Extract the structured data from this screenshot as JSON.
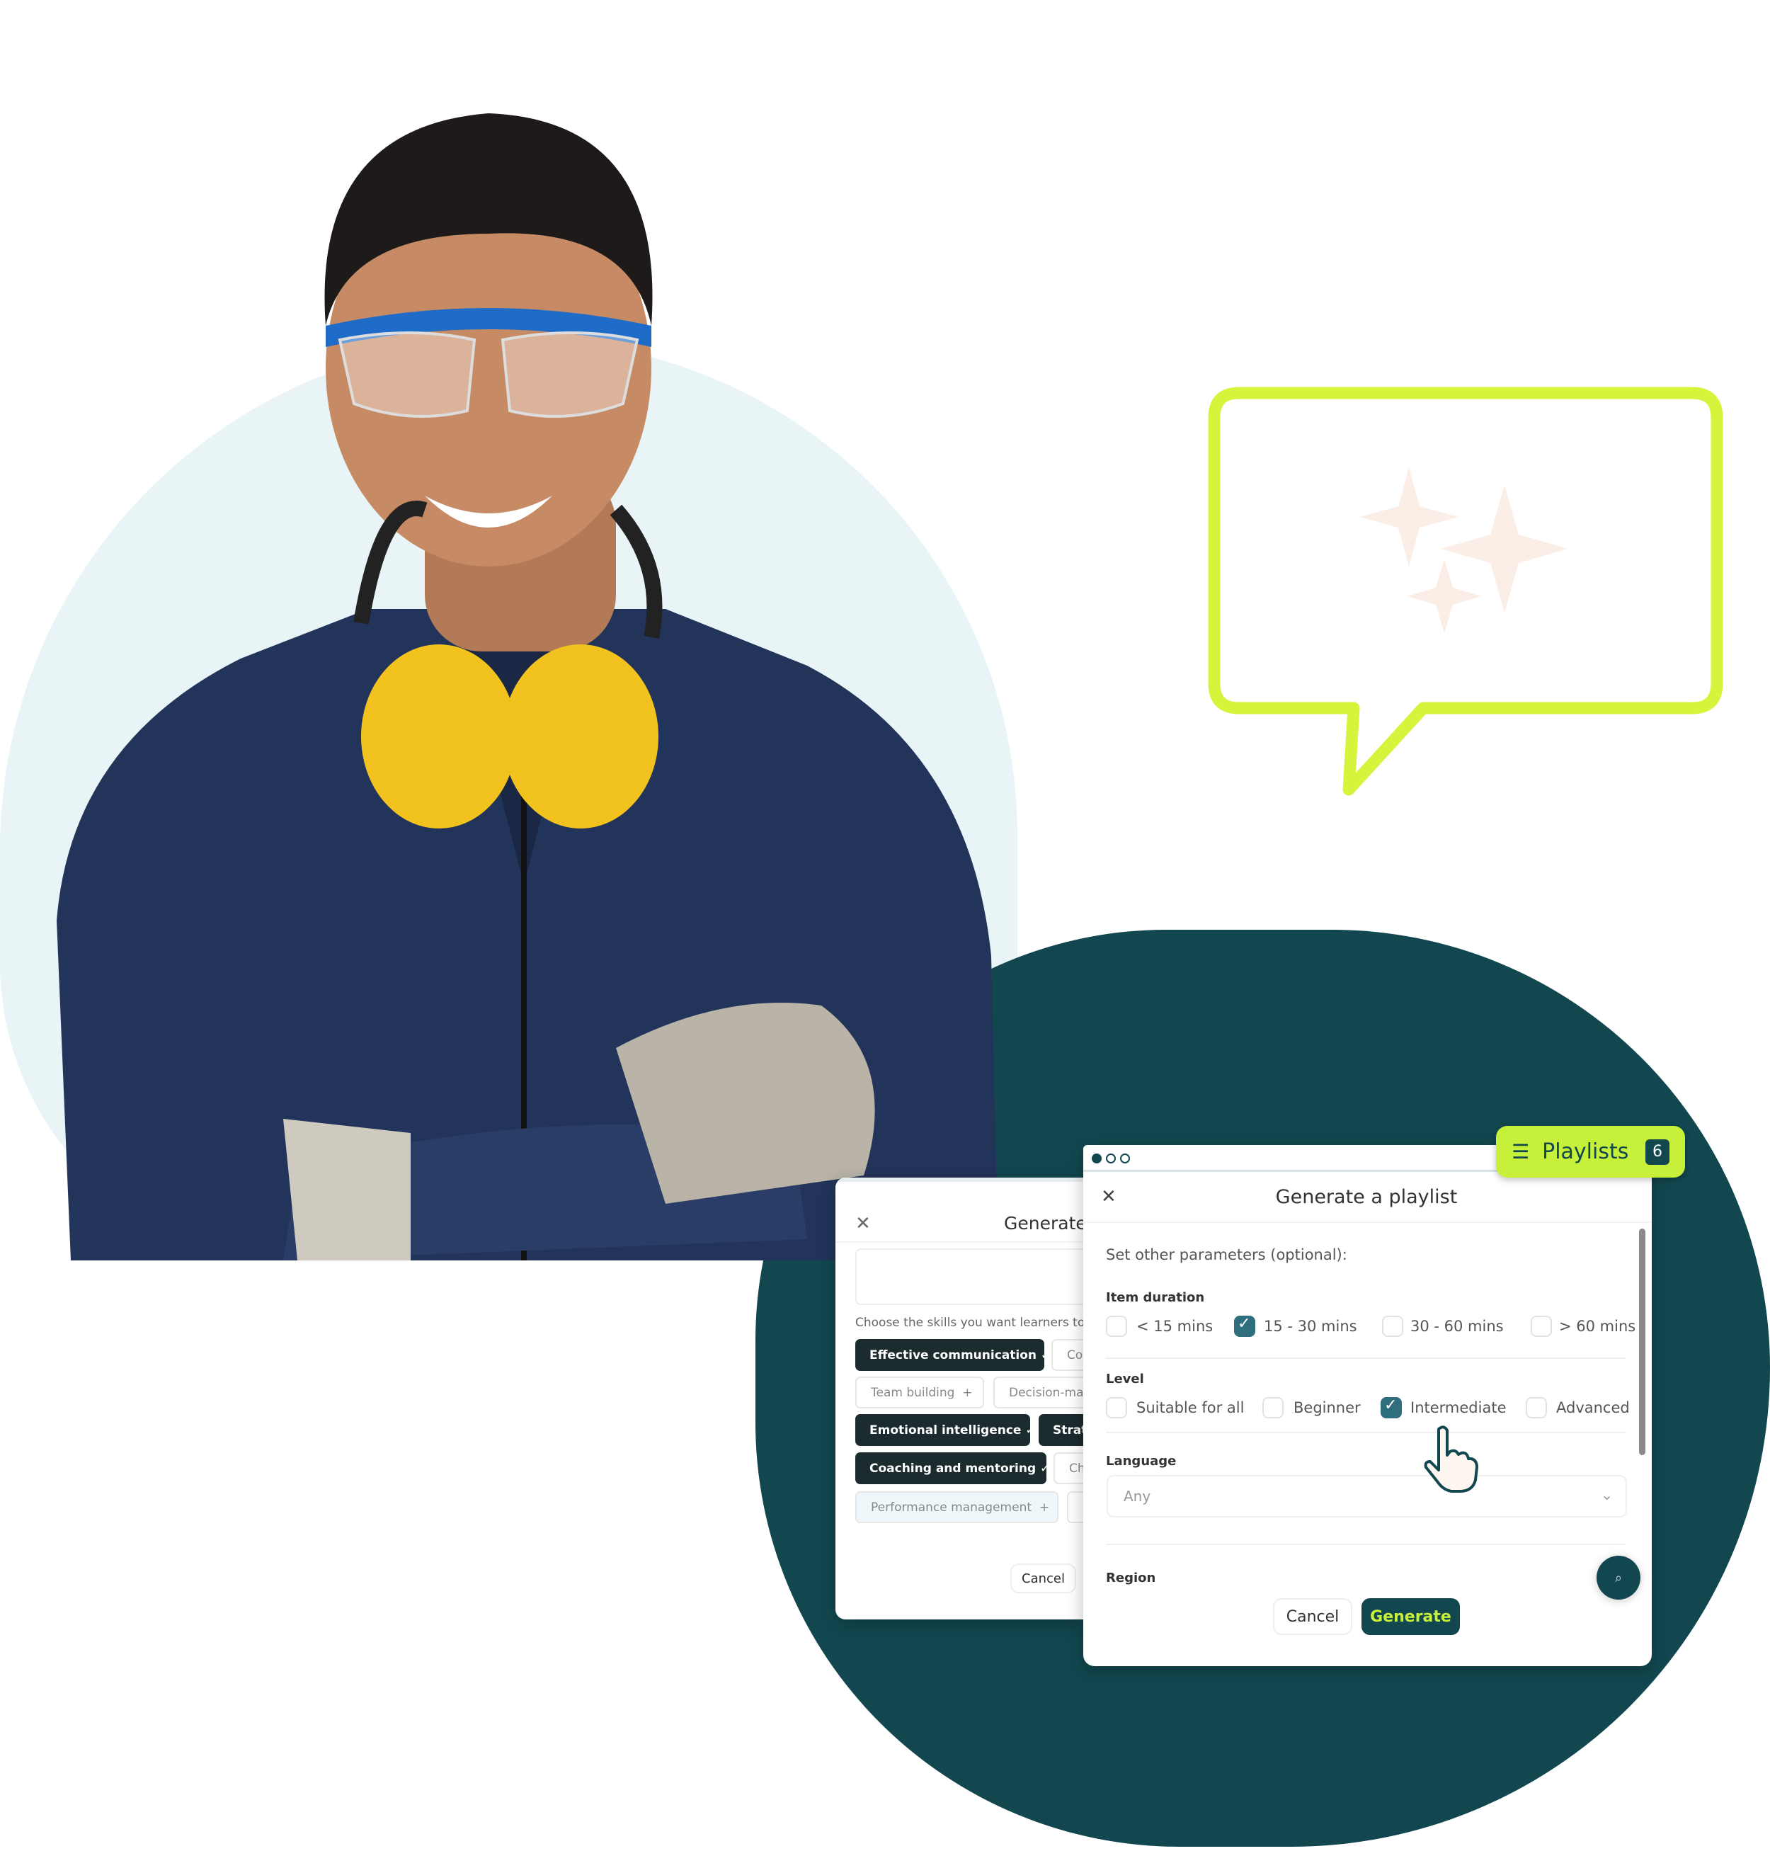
{
  "colors": {
    "accent_lime": "#d4f53c",
    "teal": "#12474f",
    "checkbox": "#2e6e7d",
    "light_bg": "#e8f4f6"
  },
  "badge": {
    "icon": "stack-icon",
    "label": "Playlists",
    "count": "6"
  },
  "back_modal": {
    "title": "Generate a",
    "skills_prompt": "Choose the skills you want learners to d",
    "chips": [
      {
        "label": "Effective communication",
        "selected": true
      },
      {
        "label": "Co",
        "selected": false
      },
      {
        "label": "Team building",
        "selected": false
      },
      {
        "label": "Decision-mal",
        "selected": false
      },
      {
        "label": "Emotional intelligence",
        "selected": true
      },
      {
        "label": "Strat",
        "selected": true
      },
      {
        "label": "Coaching and mentoring",
        "selected": true
      },
      {
        "label": "Ch",
        "selected": false
      },
      {
        "label": "Performance management",
        "selected": false
      }
    ],
    "cancel": "Cancel"
  },
  "front_modal": {
    "title": "Generate a playlist",
    "intro": "Set other parameters (optional):",
    "duration": {
      "label": "Item duration",
      "options": [
        {
          "label": "< 15 mins",
          "checked": false
        },
        {
          "label": "15 - 30 mins",
          "checked": true
        },
        {
          "label": "30 - 60 mins",
          "checked": false
        },
        {
          "label": "> 60 mins",
          "checked": false
        }
      ]
    },
    "level": {
      "label": "Level",
      "options": [
        {
          "label": "Suitable for all",
          "checked": false
        },
        {
          "label": "Beginner",
          "checked": false
        },
        {
          "label": "Intermediate",
          "checked": true
        },
        {
          "label": "Advanced",
          "checked": false
        }
      ]
    },
    "language": {
      "label": "Language",
      "value": "Any"
    },
    "region": {
      "label": "Region"
    },
    "cancel": "Cancel",
    "generate": "Generate"
  }
}
